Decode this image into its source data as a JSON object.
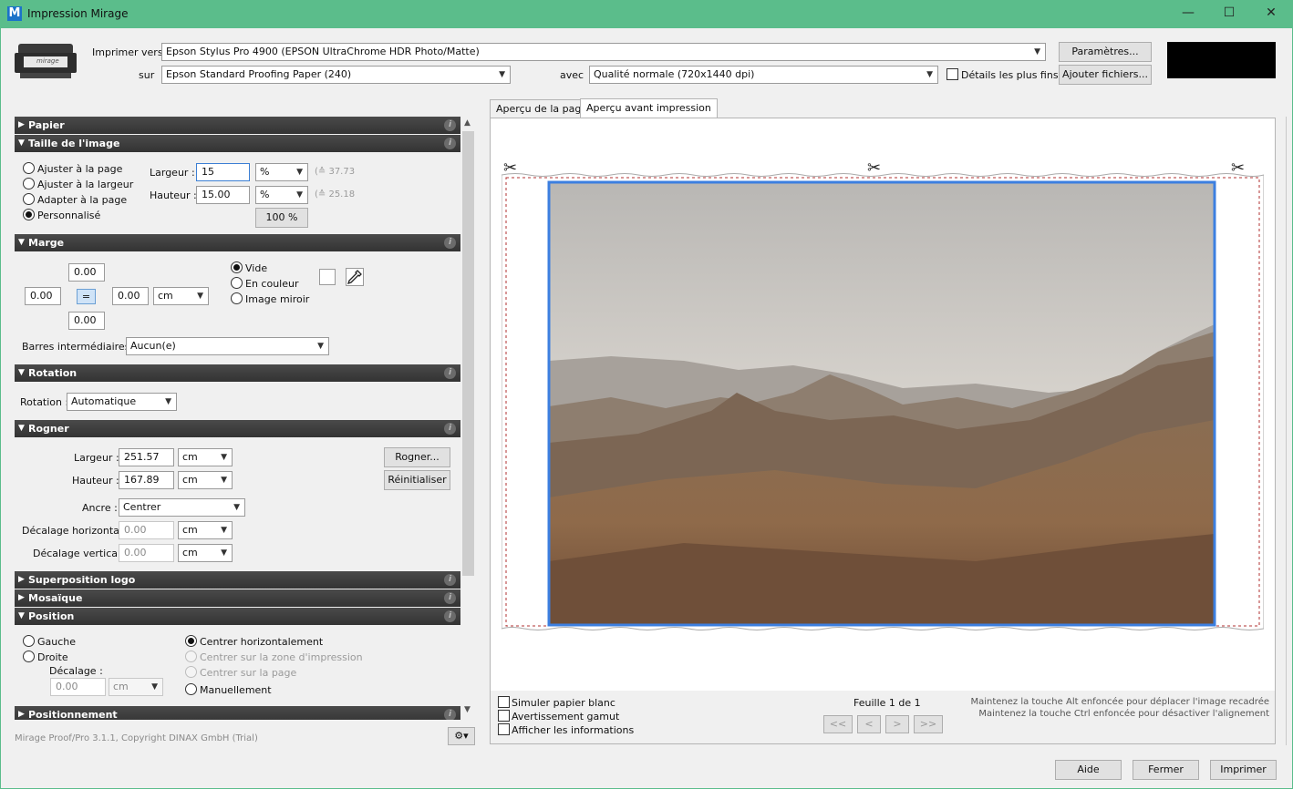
{
  "window": {
    "title": "Impression Mirage",
    "logo_letter": "M"
  },
  "top": {
    "print_to_label": "Imprimer vers",
    "printer": "Epson Stylus Pro 4900 (EPSON UltraChrome HDR Photo/Matte)",
    "on_label": "sur",
    "paper": "Epson Standard Proofing Paper (240)",
    "with_label": "avec",
    "quality": "Qualité normale (720x1440 dpi)",
    "fine_details_label": "Détails les plus fins",
    "settings_button": "Paramètres...",
    "add_files_button": "Ajouter fichiers...",
    "printer_icon_text": "mirage"
  },
  "sections": {
    "paper": "Papier",
    "image_size": "Taille de l'image",
    "margin": "Marge",
    "rotation": "Rotation",
    "crop": "Rogner",
    "logo": "Superposition logo",
    "mosaic": "Mosaïque",
    "position": "Position",
    "positioning": "Positionnement"
  },
  "image_size": {
    "options": [
      "Ajuster à la page",
      "Ajuster à la largeur",
      "Adapter à la page",
      "Personnalisé"
    ],
    "width_label": "Largeur :",
    "width_value": "15",
    "width_unit": "%",
    "width_hint": "(≙ 37.73",
    "height_label": "Hauteur :",
    "height_value": "15.00",
    "height_unit": "%",
    "height_hint": "(≙ 25.18",
    "hundred_button": "100 %"
  },
  "margin": {
    "top": "0.00",
    "left": "0.00",
    "right": "0.00",
    "bottom": "0.00",
    "equal": "=",
    "unit": "cm",
    "fill_options": [
      "Vide",
      "En couleur",
      "Image miroir"
    ],
    "bars_label": "Barres intermédiaires :",
    "bars_value": "Aucun(e)"
  },
  "rotation": {
    "label": "Rotation :",
    "value": "Automatique"
  },
  "crop": {
    "width_label": "Largeur :",
    "width_value": "251.57",
    "height_label": "Hauteur :",
    "height_value": "167.89",
    "unit": "cm",
    "crop_button": "Rogner...",
    "reset_button": "Réinitialiser",
    "anchor_label": "Ancre :",
    "anchor_value": "Centrer",
    "hoffset_label": "Décalage horizontal :",
    "hoffset_value": "0.00",
    "voffset_label": "Décalage vertical :",
    "voffset_value": "0.00"
  },
  "position": {
    "left": "Gauche",
    "right": "Droite",
    "offset_label": "Décalage :",
    "offset_value": "0.00",
    "offset_unit": "cm",
    "center_h": "Centrer horizontalement",
    "center_print": "Centrer sur la zone d'impression",
    "center_page": "Centrer sur la page",
    "manual": "Manuellement"
  },
  "footer": {
    "copyright": "Mirage Proof/Pro 3.1.1, Copyright DINAX GmbH (Trial)"
  },
  "tabs": {
    "page_preview": "Aperçu de la page",
    "print_preview": "Aperçu avant impression"
  },
  "preview_bottom": {
    "simulate_white": "Simuler papier blanc",
    "gamut_warning": "Avertissement gamut",
    "show_info": "Afficher les informations",
    "sheet": "Feuille 1 de 1",
    "nav_first": "<<",
    "nav_prev": "<",
    "nav_next": ">",
    "nav_last": ">>",
    "hint_alt": "Maintenez la touche Alt enfoncée pour déplacer l'image recadrée",
    "hint_ctrl": "Maintenez la touche Ctrl enfoncée pour désactiver l'alignement"
  },
  "bottom_buttons": {
    "help": "Aide",
    "close": "Fermer",
    "print": "Imprimer"
  }
}
